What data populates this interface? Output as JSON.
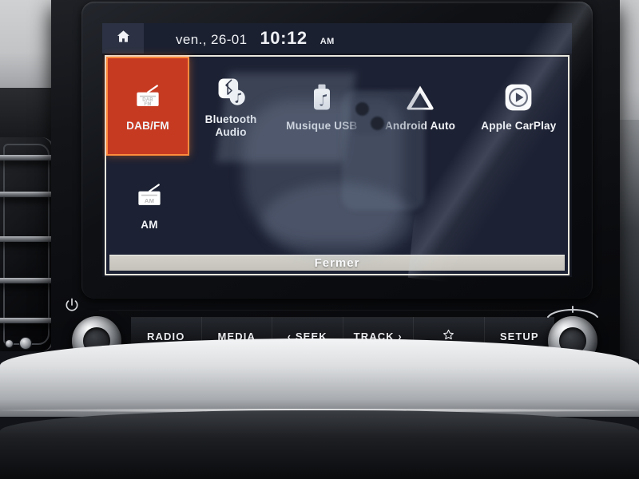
{
  "device": {
    "name": "car-infotainment-head-unit",
    "brand_accent": "#c73a22"
  },
  "screen": {
    "status_bar": {
      "home_icon": "home-icon",
      "date": "ven., 26-01",
      "time": "10:12",
      "ampm": "AM"
    },
    "dialog": {
      "title": "",
      "sources": [
        {
          "label": "DAB/FM",
          "icon": "radio-dabfm-icon",
          "selected": true
        },
        {
          "label": "Bluetooth Audio",
          "icon": "bluetooth-audio-icon",
          "selected": false
        },
        {
          "label": "Musique USB",
          "icon": "usb-music-icon",
          "selected": false
        },
        {
          "label": "Android Auto",
          "icon": "android-auto-icon",
          "selected": false
        },
        {
          "label": "Apple CarPlay",
          "icon": "apple-carplay-icon",
          "selected": false
        },
        {
          "label": "AM",
          "icon": "radio-am-icon",
          "selected": false
        }
      ],
      "close_button": "Fermer"
    }
  },
  "hardware": {
    "buttons": [
      {
        "label": "RADIO",
        "icon": ""
      },
      {
        "label": "MEDIA",
        "icon": ""
      },
      {
        "label": "‹ SEEK",
        "icon": ""
      },
      {
        "label": "TRACK ›",
        "icon": ""
      },
      {
        "label": "",
        "icon": "star-icon"
      },
      {
        "label": "SETUP",
        "icon": ""
      }
    ],
    "left_knob": "volume-power-knob",
    "right_knob": "tune-knob",
    "power_icon": "power-icon",
    "tune_arc_icon": "tune-arc-icon"
  }
}
